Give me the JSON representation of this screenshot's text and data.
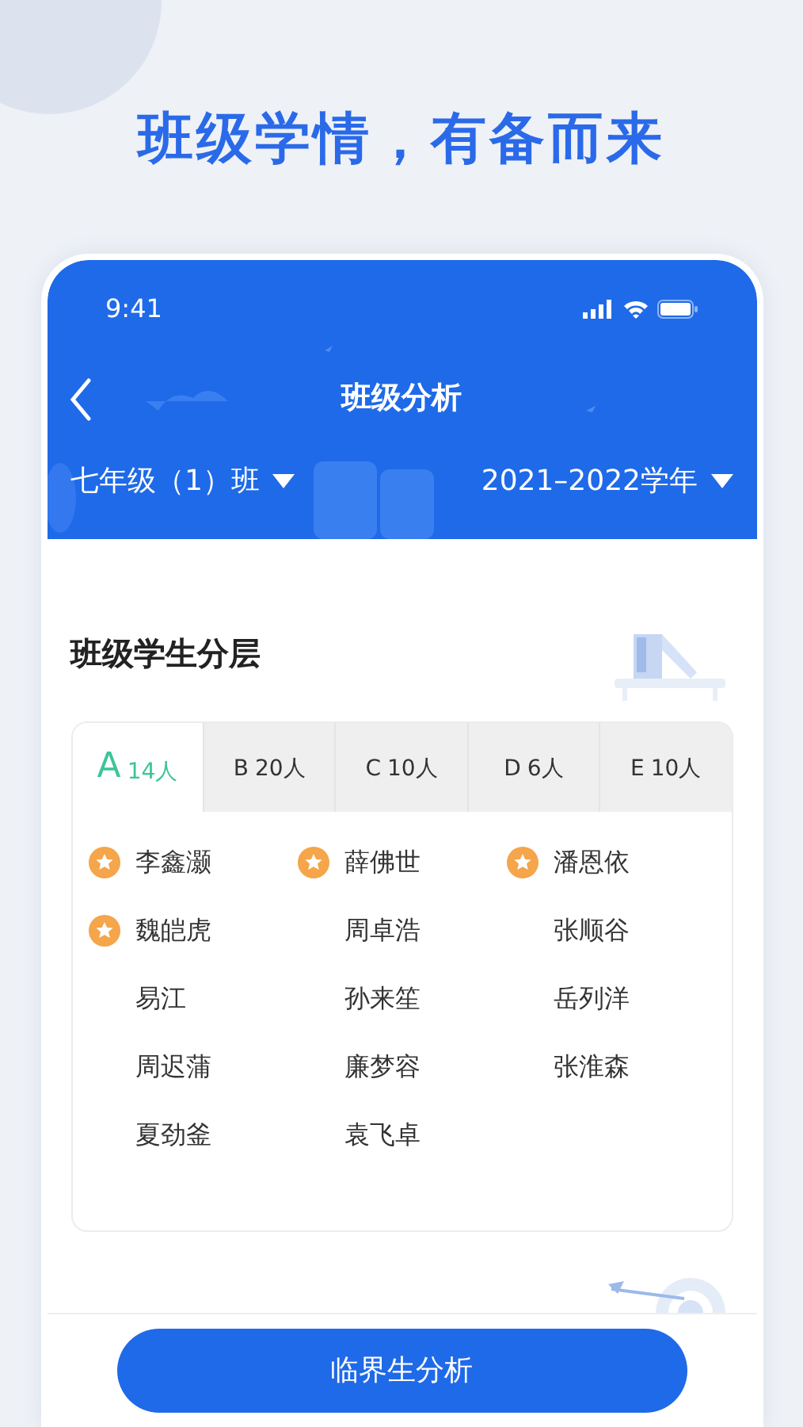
{
  "headline": "班级学情，有备而来",
  "status_bar": {
    "time": "9:41"
  },
  "nav": {
    "title": "班级分析"
  },
  "selectors": [
    {
      "label": "七年级（1）班"
    },
    {
      "label": "2021–2022学年"
    }
  ],
  "section": {
    "title": "班级学生分层"
  },
  "tabs": [
    {
      "grade": "A",
      "count": "14人",
      "selected": true
    },
    {
      "grade": "B",
      "count": "20人",
      "selected": false
    },
    {
      "grade": "C",
      "count": "10人",
      "selected": false
    },
    {
      "grade": "D",
      "count": "6人",
      "selected": false
    },
    {
      "grade": "E",
      "count": "10人",
      "selected": false
    }
  ],
  "students": [
    {
      "name": "李鑫灏",
      "starred": true
    },
    {
      "name": "薛佛世",
      "starred": true
    },
    {
      "name": "潘恩依",
      "starred": true
    },
    {
      "name": "魏皑虎",
      "starred": true
    },
    {
      "name": "周卓浩",
      "starred": false
    },
    {
      "name": "张顺谷",
      "starred": false
    },
    {
      "name": "易江",
      "starred": false
    },
    {
      "name": "孙来笙",
      "starred": false
    },
    {
      "name": "岳列洋",
      "starred": false
    },
    {
      "name": "周迟蒲",
      "starred": false
    },
    {
      "name": "廉梦容",
      "starred": false
    },
    {
      "name": "张淮森",
      "starred": false
    },
    {
      "name": "夏劲釜",
      "starred": false
    },
    {
      "name": "袁飞卓",
      "starred": false
    }
  ],
  "primary_button": {
    "label": "临界生分析"
  }
}
